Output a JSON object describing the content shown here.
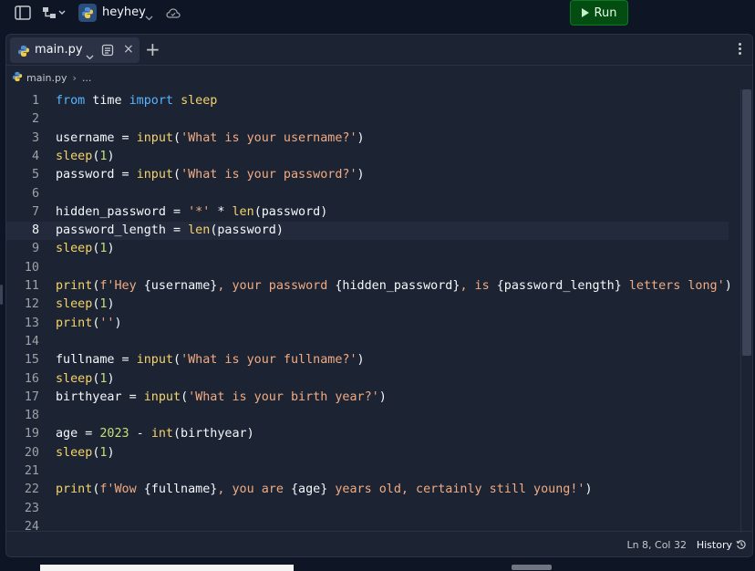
{
  "topbar": {
    "repl_name": "heyhey",
    "run_label": "Run",
    "icons": [
      "panel-toggle-icon",
      "file-tree-icon",
      "python-logo-icon",
      "chevron-down-icon",
      "cloud-sync-icon",
      "play-icon"
    ]
  },
  "tabs": [
    {
      "label": "main.py",
      "active": true
    }
  ],
  "breadcrumb": {
    "file": "main.py",
    "more": "..."
  },
  "editor": {
    "active_line": 8,
    "lines": [
      "from time import sleep",
      "",
      "username = input('What is your username?')",
      "sleep(1)",
      "password = input('What is your password?')",
      "",
      "hidden_password = '*' * len(password)",
      "password_length = len(password)",
      "sleep(1)",
      "",
      "print(f'Hey {username}, your password {hidden_password}, is {password_length} letters long')",
      "sleep(1)",
      "print('')",
      "",
      "fullname = input('What is your fullname?')",
      "sleep(1)",
      "birthyear = input('What is your birth year?')",
      "",
      "age = 2023 - int(birthyear)",
      "sleep(1)",
      "",
      "print(f'Wow {fullname}, you are {age} years old, certainly still young!')",
      "",
      ""
    ]
  },
  "status": {
    "position": "Ln 8, Col 32",
    "history_label": "History"
  },
  "colors": {
    "background": "#0e1525",
    "panel": "#1c2333",
    "keyword": "#56b6ff",
    "function": "#f5d46b",
    "string": "#f1ab82",
    "number": "#c2e07a",
    "run_button": "#034d12"
  }
}
